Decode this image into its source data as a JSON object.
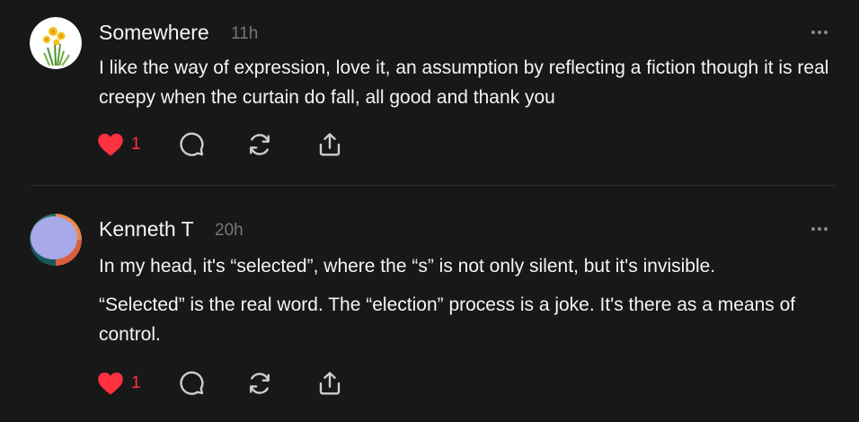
{
  "posts": [
    {
      "username": "Somewhere",
      "time": "11h",
      "avatar_icon": "daffodil-flower-avatar",
      "paragraphs": [
        "I like the way of expression, love it, an assumption by reflecting a fiction though it is real creepy when the curtain do fall, all good and thank you"
      ],
      "likes": "1",
      "liked": true
    },
    {
      "username": "Kenneth T",
      "time": "20h",
      "avatar_icon": "gradient-circle-avatar",
      "paragraphs": [
        "In my head, it's “selected”, where the “s” is not only silent, but it's invisible.",
        "“Selected” is the real word. The “election” process is a joke. It's there as a means of control."
      ],
      "likes": "1",
      "liked": true
    }
  ],
  "colors": {
    "background": "#181818",
    "text": "#f3f5f7",
    "secondary_text": "#777777",
    "like_red": "#ff3040",
    "icon_gray": "#cfcfcf",
    "divider": "#2d2d2d"
  },
  "icons": {
    "like": "heart-icon",
    "reply": "comment-bubble-icon",
    "repost": "repost-icon",
    "share": "share-icon",
    "more": "more-options-icon"
  }
}
